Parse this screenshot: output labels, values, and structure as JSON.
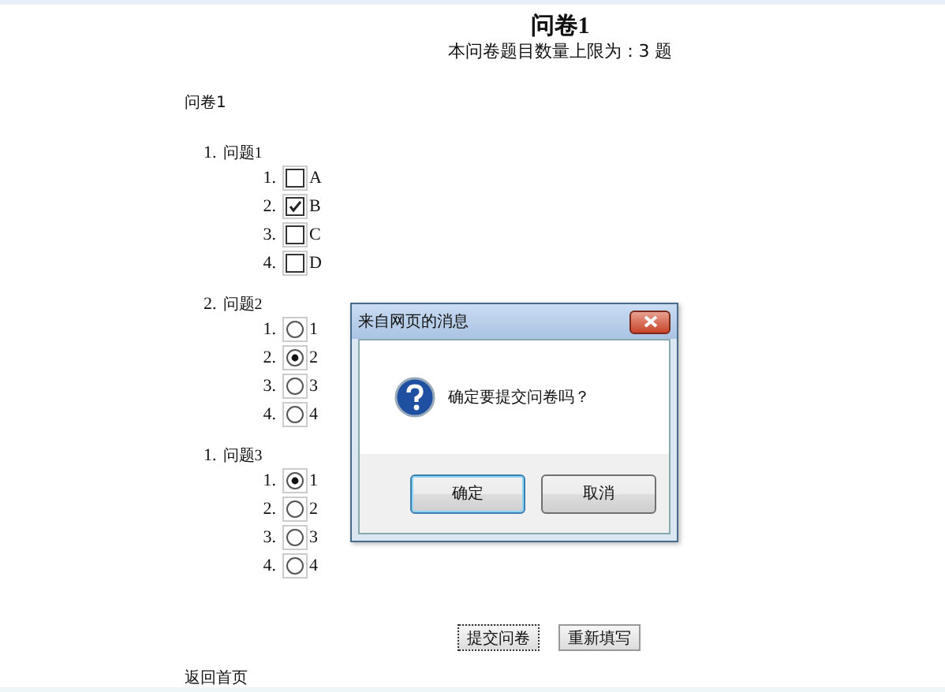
{
  "title": "问卷1",
  "subtitle": "本问卷题目数量上限为：3 题",
  "survey_name": "问卷1",
  "questions": [
    {
      "number": "1.",
      "label": "问题1",
      "kind": "checkbox",
      "options": [
        {
          "number": "1.",
          "label": "A",
          "checked": false
        },
        {
          "number": "2.",
          "label": "B",
          "checked": true
        },
        {
          "number": "3.",
          "label": "C",
          "checked": false
        },
        {
          "number": "4.",
          "label": "D",
          "checked": false
        }
      ]
    },
    {
      "number": "2.",
      "label": "问题2",
      "kind": "radio",
      "options": [
        {
          "number": "1.",
          "label": "1",
          "checked": false
        },
        {
          "number": "2.",
          "label": "2",
          "checked": true
        },
        {
          "number": "3.",
          "label": "3",
          "checked": false
        },
        {
          "number": "4.",
          "label": "4",
          "checked": false
        }
      ]
    },
    {
      "number": "1.",
      "label": "问题3",
      "kind": "radio",
      "options": [
        {
          "number": "1.",
          "label": "1",
          "checked": true
        },
        {
          "number": "2.",
          "label": "2",
          "checked": false
        },
        {
          "number": "3.",
          "label": "3",
          "checked": false
        },
        {
          "number": "4.",
          "label": "4",
          "checked": false
        }
      ]
    }
  ],
  "actions": [
    {
      "label": "提交问卷",
      "selected": true
    },
    {
      "label": "重新填写",
      "selected": false
    }
  ],
  "back_link": "返回首页",
  "dialog": {
    "title": "来自网页的消息",
    "message": "确定要提交问卷吗？",
    "buttons": [
      {
        "label": "确定",
        "selected": true
      },
      {
        "label": "取消",
        "selected": false
      }
    ]
  }
}
